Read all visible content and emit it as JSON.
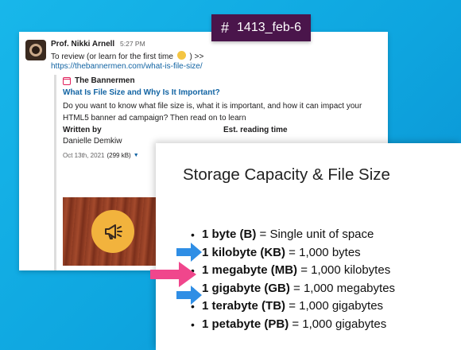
{
  "channel": {
    "name": "1413_feb-6"
  },
  "message": {
    "author": "Prof. Nikki Arnell",
    "time": "5:27 PM",
    "text_before_emoji": "To review (or learn for the first time",
    "text_after_emoji": ") >>",
    "emoji": "smiling-face-emoji",
    "link": "https://thebannermen.com/what-is-file-size/",
    "unfurl": {
      "source": "The Bannermen",
      "title": "What Is File Size and Why Is It Important?",
      "description": "Do you want to know what file size is, what it is important, and how it can impact your HTML5 banner ad campaign? Then read on to learn",
      "fields": [
        {
          "label": "Written by",
          "value": "Danielle Demkiw"
        },
        {
          "label": "Est. reading time",
          "value": ""
        }
      ],
      "date": "Oct 13th, 2021",
      "size": "(299 kB)",
      "preview_icon": "megaphone-icon"
    }
  },
  "slide": {
    "title": "Storage Capacity & File Size",
    "items": [
      {
        "term": "1 byte (B)",
        "definition": " = Single unit of space"
      },
      {
        "term": "1 kilobyte (KB)",
        "definition": " = 1,000 bytes"
      },
      {
        "term": "1 megabyte (MB)",
        "definition": " = 1,000 kilobytes"
      },
      {
        "term": "1 gigabyte (GB)",
        "definition": " = 1,000 megabytes"
      },
      {
        "term": "1 terabyte (TB)",
        "definition": " = 1,000 gigabytes"
      },
      {
        "term": "1 petabyte (PB)",
        "definition": " = 1,000 gigabytes"
      }
    ]
  },
  "arrows": [
    {
      "name": "kilobyte-arrow",
      "color": "#2f8ee5"
    },
    {
      "name": "megabyte-arrow",
      "color": "#f0468c"
    },
    {
      "name": "gigabyte-arrow",
      "color": "#2f8ee5"
    }
  ],
  "colors": {
    "background": "#16b3e8",
    "channel_tag": "#4a154b",
    "link": "#1264a3",
    "accent_pink": "#f0468c",
    "accent_blue": "#2f8ee5"
  }
}
